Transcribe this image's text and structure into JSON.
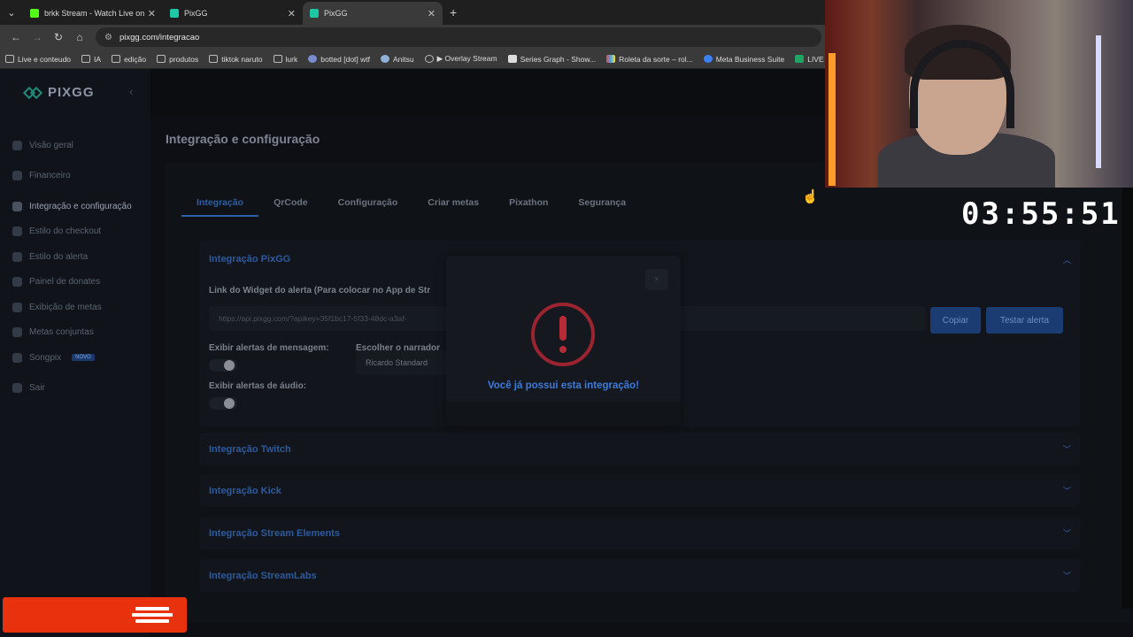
{
  "browser": {
    "tabs": [
      {
        "title": "brkk Stream - Watch Live on Ki",
        "favicon_color": "#53fc18",
        "active": false
      },
      {
        "title": "PixGG",
        "favicon_color": "#1ec7a4",
        "active": false
      },
      {
        "title": "PixGG",
        "favicon_color": "#1ec7a4",
        "active": true
      }
    ],
    "address": "pixgg.com/integracao",
    "bookmarks": [
      {
        "label": "Live e conteudo",
        "icon": "folder-icon"
      },
      {
        "label": "IA",
        "icon": "folder-icon"
      },
      {
        "label": "edição",
        "icon": "folder-icon"
      },
      {
        "label": "produtos",
        "icon": "folder-icon"
      },
      {
        "label": "tiktok naruto",
        "icon": "folder-icon"
      },
      {
        "label": "lurk",
        "icon": "folder-icon"
      },
      {
        "label": "botted [dot] wtf",
        "icon": "site-icon"
      },
      {
        "label": "Anitsu",
        "icon": "site-icon"
      },
      {
        "label": "▶ Overlay Stream",
        "icon": "globe-icon"
      },
      {
        "label": "Series Graph - Show...",
        "icon": "site-icon"
      },
      {
        "label": "Roleta da sorte – rol...",
        "icon": "site-icon"
      },
      {
        "label": "Meta Business Suite",
        "icon": "meta-icon"
      },
      {
        "label": "LIVE - Goog",
        "icon": "sheets-icon"
      }
    ]
  },
  "sidebar": {
    "logo": "PIXGG",
    "items": [
      {
        "label": "Visão geral",
        "icon": "home-icon"
      },
      {
        "label": "Financeiro",
        "icon": "wallet-icon"
      },
      {
        "label": "Integração e configuração",
        "icon": "settings-icon",
        "active": true
      },
      {
        "label": "Estilo do checkout",
        "icon": "palette-icon"
      },
      {
        "label": "Estilo do alerta",
        "icon": "palette-icon"
      },
      {
        "label": "Painel de donates",
        "icon": "panel-icon"
      },
      {
        "label": "Exibição de metas",
        "icon": "star-icon"
      },
      {
        "label": "Metas conjuntas",
        "icon": "group-icon"
      },
      {
        "label": "Songpix",
        "icon": "music-icon",
        "badge": "NOVO"
      },
      {
        "label": "Sair",
        "icon": "logout-icon"
      }
    ]
  },
  "main": {
    "title": "Integração e configuração",
    "tabs": [
      "Integração",
      "QrCode",
      "Configuração",
      "Criar metas",
      "Pixathon",
      "Segurança"
    ],
    "sections": {
      "pixgg": {
        "title": "Integração PixGG",
        "widget_label": "Link do Widget do alerta (Para colocar no App de Str",
        "widget_url": "https://api.pixgg.com/?apikey=35f1bc17-5f33-48dc-a3af-",
        "copy_button": "Copiar",
        "test_button": "Testar alerta",
        "message_alerts_label": "Exibir alertas de mensagem:",
        "audio_alerts_label": "Exibir alertas de áudio:",
        "narrator_label": "Escolher o narrador",
        "narrator_value": "Ricardo Standard"
      },
      "collapsed": [
        "Integração Twitch",
        "Integração Kick",
        "Integração Stream Elements",
        "Integração StreamLabs"
      ]
    }
  },
  "modal": {
    "close": "×",
    "message": "Você já possui esta integração!"
  },
  "overlay": {
    "timer": "03:55:51"
  }
}
